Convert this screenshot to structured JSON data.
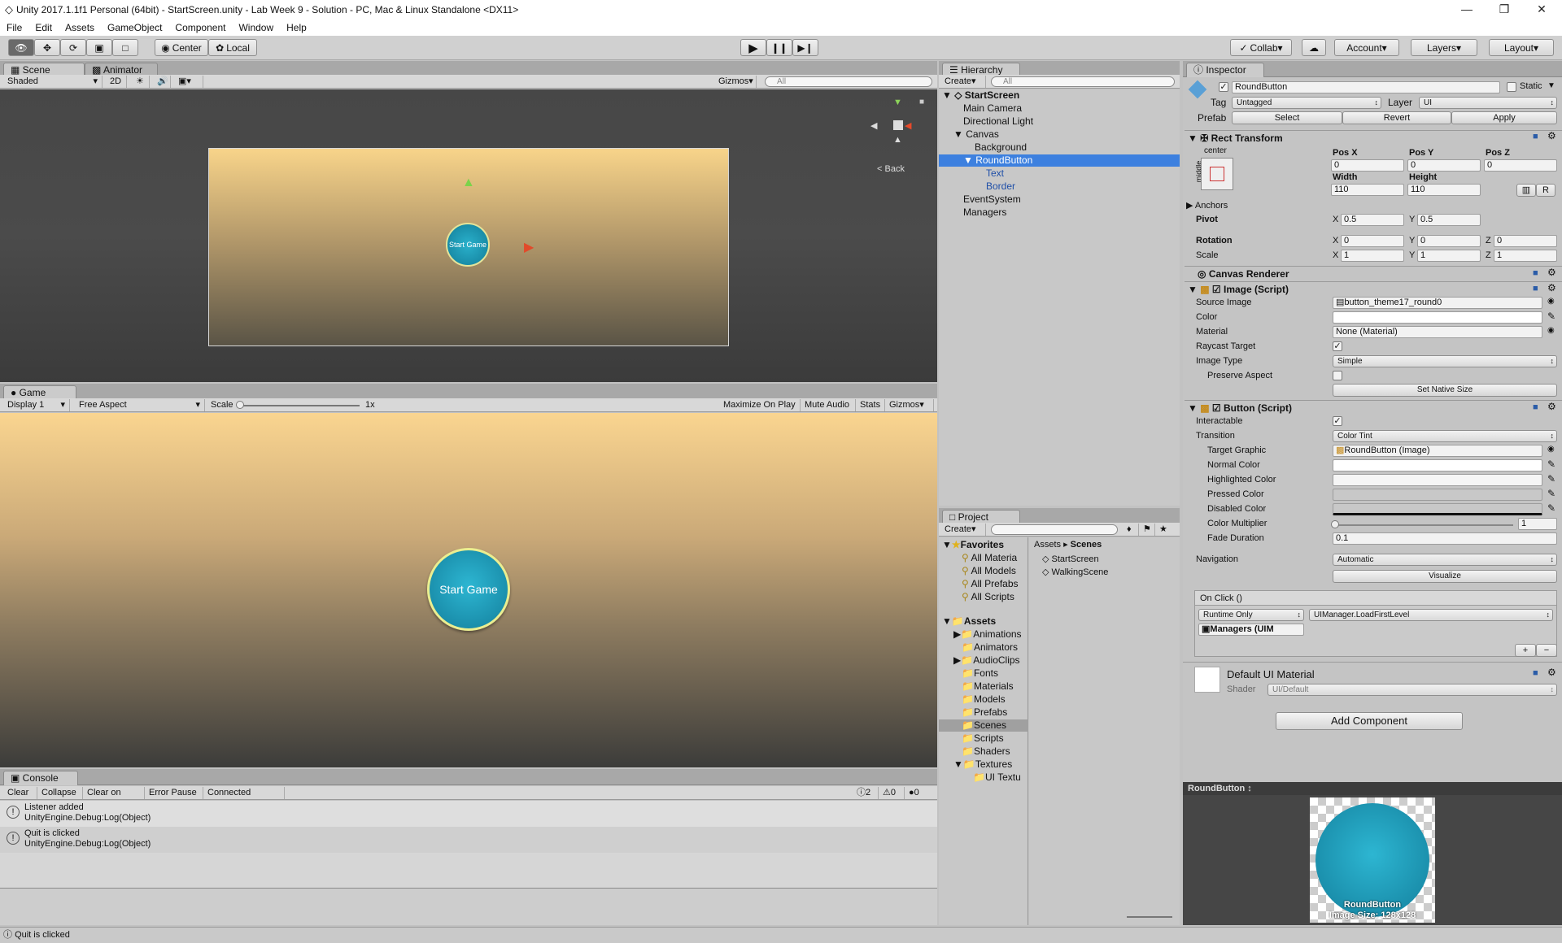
{
  "window": {
    "title": "Unity 2017.1.1f1 Personal (64bit) - StartScreen.unity - Lab Week 9 - Solution - PC, Mac & Linux Standalone <DX11>"
  },
  "menu": [
    "File",
    "Edit",
    "Assets",
    "GameObject",
    "Component",
    "Window",
    "Help"
  ],
  "toolbar": {
    "center": "Center",
    "local": "Local",
    "collab": "Collab",
    "account": "Account",
    "layers": "Layers",
    "layout": "Layout"
  },
  "scene": {
    "tab": "Scene",
    "tab2": "Animator",
    "shading": "Shaded",
    "mode2d": "2D",
    "gizmos": "Gizmos",
    "search": "All",
    "back": "Back",
    "btn_text": "Start Game"
  },
  "game": {
    "tab": "Game",
    "display": "Display 1",
    "aspect": "Free Aspect",
    "scale": "Scale",
    "scale_val": "1x",
    "maximize": "Maximize On Play",
    "mute": "Mute Audio",
    "stats": "Stats",
    "gizmos": "Gizmos",
    "button_label": "Start Game"
  },
  "console": {
    "tab": "Console",
    "clear": "Clear",
    "collapse": "Collapse",
    "clear_on_play": "Clear on Play",
    "error_pause": "Error Pause",
    "connected": "Connected Player",
    "count_log": "2",
    "count_warn": "0",
    "count_err": "0",
    "entries": [
      {
        "line1": "Listener added",
        "line2": "UnityEngine.Debug:Log(Object)"
      },
      {
        "line1": "Quit is clicked",
        "line2": "UnityEngine.Debug:Log(Object)"
      }
    ]
  },
  "status": "Quit is clicked",
  "hierarchy": {
    "tab": "Hierarchy",
    "create": "Create",
    "search": "All",
    "scene": "StartScreen",
    "items": [
      "Main Camera",
      "Directional Light",
      "Canvas",
      "Background",
      "RoundButton",
      "Text",
      "Border",
      "EventSystem",
      "Managers"
    ]
  },
  "project": {
    "tab": "Project",
    "create": "Create",
    "favorites": "Favorites",
    "fav_items": [
      "All Materia",
      "All Models",
      "All Prefabs",
      "All Scripts"
    ],
    "assets": "Assets",
    "folders": [
      "Animations",
      "Animators",
      "AudioClips",
      "Fonts",
      "Materials",
      "Models",
      "Prefabs",
      "Scenes",
      "Scripts",
      "Shaders",
      "Textures",
      "UI Textu"
    ],
    "breadcrumb_root": "Assets",
    "breadcrumb_leaf": "Scenes",
    "files": [
      "StartScreen",
      "WalkingScene"
    ]
  },
  "inspector": {
    "tab": "Inspector",
    "name": "RoundButton",
    "static": "Static",
    "tag_label": "Tag",
    "tag": "Untagged",
    "layer_label": "Layer",
    "layer": "UI",
    "prefab_label": "Prefab",
    "select": "Select",
    "revert": "Revert",
    "apply": "Apply",
    "rect": {
      "title": "Rect Transform",
      "center": "center",
      "middle": "middle",
      "posx_l": "Pos X",
      "posy_l": "Pos Y",
      "posz_l": "Pos Z",
      "posx": "0",
      "posy": "0",
      "posz": "0",
      "width_l": "Width",
      "height_l": "Height",
      "width": "110",
      "height": "110",
      "anchors": "Anchors",
      "pivot": "Pivot",
      "pivot_x": "0.5",
      "pivot_y": "0.5",
      "rotation": "Rotation",
      "rot_x": "0",
      "rot_y": "0",
      "rot_z": "0",
      "scale": "Scale",
      "sx": "1",
      "sy": "1",
      "sz": "1",
      "x": "X",
      "y": "Y",
      "z": "Z",
      "r": "R"
    },
    "canvas_renderer": "Canvas Renderer",
    "image": {
      "title": "Image (Script)",
      "source_l": "Source Image",
      "source": "button_theme17_round0",
      "color_l": "Color",
      "material_l": "Material",
      "material": "None (Material)",
      "raycast_l": "Raycast Target",
      "type_l": "Image Type",
      "type": "Simple",
      "preserve_l": "Preserve Aspect",
      "native": "Set Native Size"
    },
    "button": {
      "title": "Button (Script)",
      "interactable_l": "Interactable",
      "transition_l": "Transition",
      "transition": "Color Tint",
      "target_l": "Target Graphic",
      "target": "RoundButton (Image)",
      "normal_l": "Normal Color",
      "high_l": "Highlighted Color",
      "pressed_l": "Pressed Color",
      "disabled_l": "Disabled Color",
      "mult_l": "Color Multiplier",
      "mult": "1",
      "fade_l": "Fade Duration",
      "fade": "0.1",
      "nav_l": "Navigation",
      "nav": "Automatic",
      "visualize": "Visualize",
      "onclick": "On Click ()",
      "runtime": "Runtime Only",
      "func": "UIManager.LoadFirstLevel",
      "obj": "Managers (UIM"
    },
    "material": {
      "name": "Default UI Material",
      "shader_l": "Shader",
      "shader": "UI/Default"
    },
    "add_component": "Add Component",
    "preview": {
      "title": "RoundButton",
      "label": "RoundButton",
      "size": "Image Size: 128x128"
    }
  }
}
